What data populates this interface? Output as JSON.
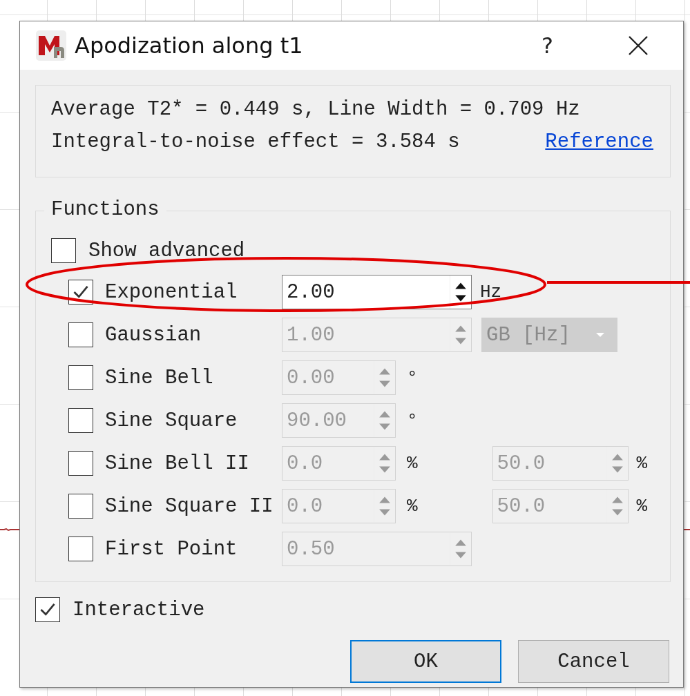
{
  "window": {
    "title": "Apodization along t1",
    "help": "?"
  },
  "info": {
    "lines": [
      "Average T2* = 0.449 s, Line Width = 0.709 Hz",
      "Integral-to-noise effect = 3.584 s"
    ],
    "link": "Reference"
  },
  "functions": {
    "title": "Functions",
    "show_advanced": {
      "label": "Show advanced",
      "checked": false
    },
    "rows": [
      {
        "label": "Exponential",
        "checked": true,
        "disabled": false,
        "controls": [
          {
            "kind": "long-spin",
            "value": "2.00",
            "unit": "Hz"
          }
        ]
      },
      {
        "label": "Gaussian",
        "checked": false,
        "disabled": true,
        "controls": [
          {
            "kind": "long-spin",
            "value": "1.00"
          },
          {
            "kind": "combo",
            "value": "GB [Hz]"
          }
        ]
      },
      {
        "label": "Sine Bell",
        "checked": false,
        "disabled": true,
        "controls": [
          {
            "kind": "short-spin",
            "value": "0.00",
            "unit": "°"
          }
        ]
      },
      {
        "label": "Sine Square",
        "checked": false,
        "disabled": true,
        "controls": [
          {
            "kind": "short-spin",
            "value": "90.00",
            "unit": "°"
          }
        ]
      },
      {
        "label": "Sine Bell II",
        "checked": false,
        "disabled": true,
        "controls": [
          {
            "kind": "short-spin",
            "value": "0.0",
            "unit": "%"
          },
          {
            "kind": "right-spin",
            "value": "50.0",
            "unit": "%"
          }
        ]
      },
      {
        "label": "Sine Square II",
        "checked": false,
        "disabled": true,
        "controls": [
          {
            "kind": "short-spin",
            "value": "0.0",
            "unit": "%"
          },
          {
            "kind": "right-spin",
            "value": "50.0",
            "unit": "%"
          }
        ]
      },
      {
        "label": "First Point",
        "checked": false,
        "disabled": true,
        "controls": [
          {
            "kind": "long-spin",
            "value": "0.50"
          }
        ]
      }
    ]
  },
  "interactive": {
    "label": "Interactive",
    "checked": true
  },
  "buttons": [
    {
      "label": "OK",
      "default": true
    },
    {
      "label": "Cancel",
      "default": false
    }
  ]
}
